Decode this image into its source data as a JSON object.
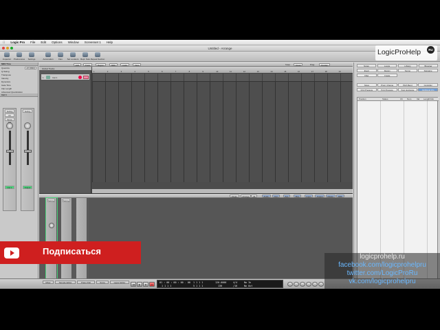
{
  "menubar": {
    "apple": "",
    "app_name": "Logic Pro",
    "items": [
      "File",
      "Edit",
      "Options",
      "Window",
      "Screenset 1",
      "Help"
    ]
  },
  "window": {
    "title": "Untitled - Arrange"
  },
  "toolbar": {
    "buttons": [
      "Inspector",
      "Preferences",
      "Settings",
      "Automation",
      "Flex",
      "Set Locators",
      "Repl. Solo",
      "Repeat Section"
    ]
  },
  "arrange": {
    "menus": [
      "Edit",
      "Track",
      "Region",
      "MIDI",
      "Audio",
      "View"
    ],
    "snap_label": "Snap:",
    "snap_value": "Smart",
    "drag_label": "Drag:",
    "drag_value": "Overlap",
    "global_tracks": "Global Tracks",
    "track_name": "Inst 1",
    "ruler": [
      "1",
      "2",
      "3",
      "4",
      "5",
      "6",
      "7",
      "8",
      "9",
      "10",
      "11",
      "12",
      "13",
      "14",
      "15",
      "16",
      "17",
      "18",
      "19"
    ]
  },
  "inspector": {
    "header": "MIDI Thru",
    "rows": [
      {
        "label": "Quantize",
        "value": "off (3840)"
      },
      {
        "label": "Q-Swing",
        "value": ""
      },
      {
        "label": "Transpose",
        "value": ""
      },
      {
        "label": "Velocity",
        "value": ""
      },
      {
        "label": "Dynamics",
        "value": ""
      },
      {
        "label": "Gate Time",
        "value": ""
      },
      {
        "label": "Clip Length",
        "value": ""
      }
    ],
    "advanced": "Advanced Quantization",
    "sub_header": "Inst 1",
    "strip_left": {
      "setting": "Setting",
      "io": "I/O",
      "out": "Stereo Out",
      "name": "Inst 1"
    },
    "strip_right": {
      "setting": "Setting",
      "out": "Output"
    }
  },
  "mixer": {
    "tabs": [
      "Single",
      "Arrange",
      "All",
      "Audio",
      "Inst",
      "Aux",
      "Bus",
      "Input",
      "Output",
      "Master",
      "MIDI"
    ],
    "strips": [
      {
        "setting": "Setting",
        "label": "Inst 1"
      },
      {
        "setting": "Setting",
        "label": "Stereo Out"
      },
      {
        "setting": "",
        "label": "Master"
      }
    ]
  },
  "right_panel": {
    "tabs": [
      "Notes",
      "Loops",
      "Library",
      "Browser"
    ],
    "subtabs": [
      "Event",
      "Region",
      "Tempo",
      "Signature"
    ],
    "filter_label": "Filter",
    "create_label": "Create",
    "row1": [
      "Notes",
      "Progr. Change",
      "Pitch Bend",
      "Controller"
    ],
    "row2": [
      "Chnl Pressure",
      "Poly Pressure",
      "Syst. Exclusive",
      "Additional Info"
    ],
    "columns": [
      "Position",
      "Status",
      "Ch",
      "Num",
      "Val",
      "Length/Info"
    ]
  },
  "transport": {
    "editor_tabs": [
      "Mixer",
      "Sample Editor",
      "Piano Roll",
      "Score",
      "Hyper Editor"
    ],
    "smpte": "01 : 00 : 00 : 00 . 00",
    "bars": "1  1  1  1",
    "bars2": "5  1  1  1",
    "tempo": "120.0000",
    "tempo_sub": "130",
    "sig": "4/4",
    "sig_sub": "/16",
    "in": "No In",
    "out": "No Out"
  },
  "overlay": {
    "subscribe": "Подписаться",
    "logo": "LogicProHelp",
    "logo_badge": "RU",
    "social": [
      "logicprohelp.ru",
      "facebook.com/logicprohelpru",
      "twitter.com/LogicProRu",
      "vk.com/logicprohelpru"
    ]
  },
  "colors": {
    "subscribe_red": "#cf1f1f",
    "social_blue": "#6ab8ff",
    "selection_green": "#4ad17a"
  }
}
